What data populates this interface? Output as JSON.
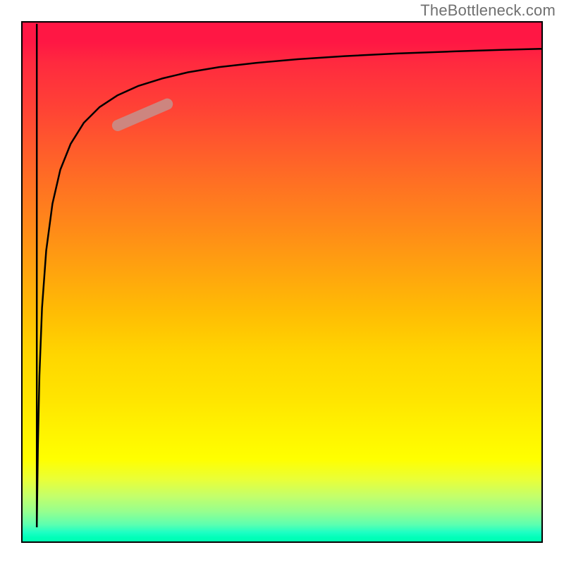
{
  "watermark": "TheBottleneck.com",
  "chart_data": {
    "type": "line",
    "title": "",
    "xlabel": "",
    "ylabel": "",
    "xlim": [
      0,
      100
    ],
    "ylim": [
      0,
      100
    ],
    "grid": false,
    "legend": false,
    "background_gradient": {
      "direction": "vertical",
      "stops": [
        {
          "pos": 0,
          "color": "#ff1744"
        },
        {
          "pos": 50,
          "color": "#ffbd04"
        },
        {
          "pos": 84,
          "color": "#ffff00"
        },
        {
          "pos": 100,
          "color": "#00ffb0"
        }
      ]
    },
    "series": [
      {
        "name": "vertical-stroke",
        "color": "#000000",
        "width": 2.5,
        "x": [
          3.0,
          3.0
        ],
        "y": [
          99.5,
          3.0
        ]
      },
      {
        "name": "log-curve",
        "color": "#000000",
        "width": 2.5,
        "x": [
          3.0,
          3.2,
          3.5,
          4.0,
          4.8,
          6.0,
          7.5,
          9.5,
          12.0,
          15.0,
          18.5,
          22.5,
          27.0,
          32.0,
          38.0,
          45.0,
          53.0,
          62.0,
          72.0,
          83.0,
          92.0,
          100.0
        ],
        "y": [
          3.0,
          18.0,
          32.0,
          45.0,
          56.0,
          65.0,
          71.5,
          76.5,
          80.5,
          83.5,
          85.8,
          87.6,
          89.0,
          90.2,
          91.2,
          92.0,
          92.7,
          93.3,
          93.8,
          94.2,
          94.5,
          94.7
        ]
      },
      {
        "name": "highlight-segment",
        "color": "#c98b85",
        "width": 16,
        "linecap": "round",
        "opacity": 0.92,
        "x": [
          18.5,
          28.0
        ],
        "y": [
          80.0,
          84.1
        ]
      }
    ]
  }
}
